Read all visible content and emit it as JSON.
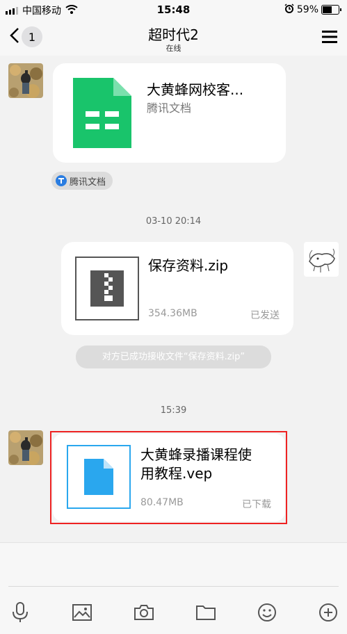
{
  "status": {
    "carrier": "中国移动",
    "time": "15:48",
    "battery": "59%"
  },
  "nav": {
    "back_count": "1",
    "title": "超时代2",
    "subtitle": "在线"
  },
  "messages": {
    "doc": {
      "title": "大黄蜂网校客...",
      "source": "腾讯文档",
      "tag": "腾讯文档"
    },
    "time1": "03-10 20:14",
    "zip": {
      "name": "保存资料.zip",
      "size": "354.36MB",
      "status": "已发送"
    },
    "system_notice": "对方已成功接收文件“保存资料.zip”",
    "time2": "15:39",
    "vep": {
      "name_line1": "大黄蜂录播课程使",
      "name_line2": "用教程.vep",
      "size": "80.47MB",
      "status": "已下载"
    }
  },
  "colors": {
    "doc_green": "#19c46b",
    "file_blue": "#2aa7ee",
    "highlight_red": "#e22222"
  },
  "icons": [
    "signal-icon",
    "wifi-icon",
    "alarm-icon",
    "battery-icon",
    "back-chevron-icon",
    "menu-icon",
    "sheet-icon",
    "tencent-docs-icon",
    "zip-icon",
    "file-icon",
    "mic-icon",
    "image-icon",
    "camera-icon",
    "folder-icon",
    "emoji-icon",
    "plus-icon"
  ]
}
